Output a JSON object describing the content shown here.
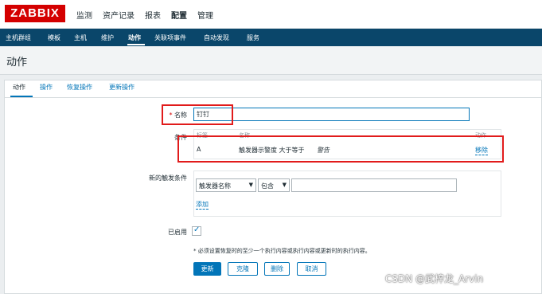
{
  "app": {
    "logo": "ZABBIX"
  },
  "main_menu": [
    "监测",
    "资产记录",
    "报表",
    "配置",
    "管理"
  ],
  "sub_menu": [
    "主机群组",
    "模板",
    "主机",
    "维护",
    "动作",
    "关联项事件",
    "自动发现",
    "服务"
  ],
  "page_title": "动作",
  "tabs": [
    "动作",
    "操作",
    "恢复操作",
    "更新操作"
  ],
  "form": {
    "name_label": "名称",
    "name_required_mark": "*",
    "name_value": "钉钉",
    "conditions_label": "条件",
    "conditions_headers": {
      "label": "标签",
      "name": "名称",
      "action": "动作"
    },
    "conditions_rows": [
      {
        "label": "A",
        "name": "触发器示警度 大于等于",
        "value": "警告",
        "action": "移除"
      }
    ],
    "new_condition_label": "新的触发条件",
    "new_condition_type": "触发器名称",
    "new_condition_operator": "包含",
    "new_condition_value": "",
    "add_link": "添加",
    "enabled_label": "已启用",
    "enabled": true,
    "hint": "* 必须设置恢复时的至少一个执行内容或执行内容或更新时的执行内容。"
  },
  "buttons": {
    "update": "更新",
    "clone": "克隆",
    "delete": "删除",
    "cancel": "取消"
  },
  "watermark": "CSDN @武梓龙_Arvin",
  "colors": {
    "brand_red": "#d40000",
    "nav_blue": "#0a466a",
    "link_blue": "#0275b8",
    "highlight_red": "#e11b1b"
  }
}
